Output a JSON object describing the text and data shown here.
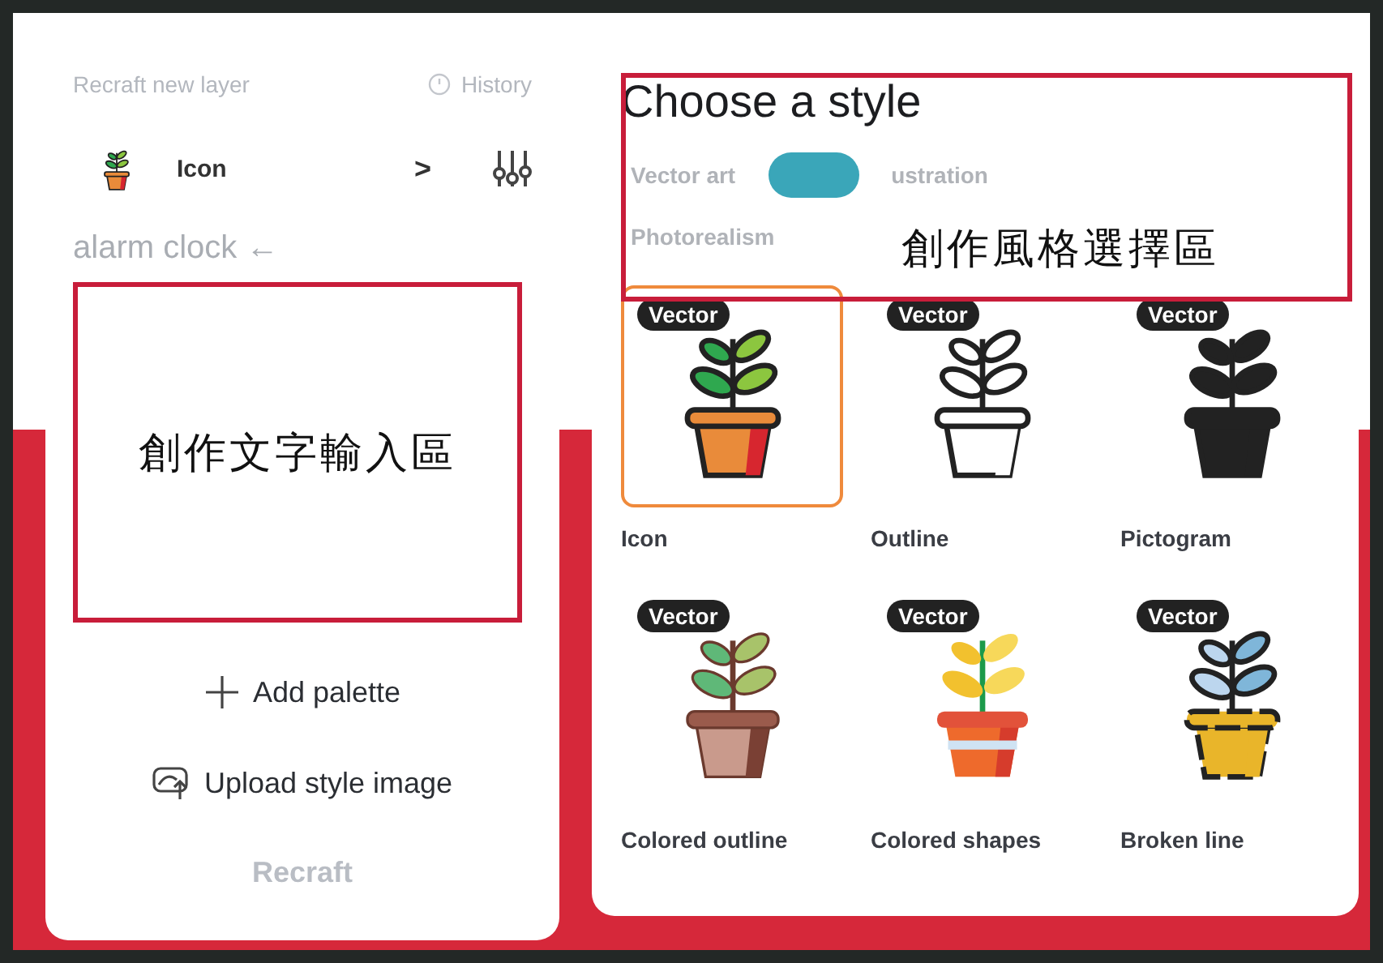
{
  "panel": {
    "title": "Recraft new layer",
    "history": "History",
    "model": {
      "label": "Icon",
      "chevron": ">"
    },
    "prompt": {
      "placeholder": "alarm clock ←"
    },
    "actions": [
      {
        "kind": "add",
        "label": "Add palette"
      },
      {
        "kind": "upload",
        "label": "Upload style image"
      }
    ],
    "submit": {
      "label": "Recraft",
      "disabled": true
    }
  },
  "styles": {
    "title": "Choose a style",
    "tabs": [
      {
        "label": "Vector art",
        "selected": false
      },
      {
        "selected": true
      },
      {
        "label": "ustration",
        "selected": false
      },
      {
        "label": "Photorealism",
        "selected": false
      }
    ],
    "items": [
      {
        "kind": "icon",
        "badge": "Vector",
        "label": "Icon",
        "selected": true
      },
      {
        "kind": "outline",
        "badge": "Vector",
        "label": "Outline",
        "selected": false
      },
      {
        "kind": "pictogram",
        "badge": "Vector",
        "label": "Pictogram",
        "selected": false
      },
      {
        "kind": "colored-outline",
        "badge": "Vector",
        "label": "Colored outline",
        "selected": false
      },
      {
        "kind": "colored-shapes",
        "badge": "Vector",
        "label": "Colored shapes",
        "selected": false
      },
      {
        "kind": "broken-line",
        "badge": "Vector",
        "label": "Broken line",
        "selected": false
      }
    ]
  },
  "annotations": [
    {
      "text": "創作文字輸入區"
    },
    {
      "text": "創作風格選擇區"
    }
  ]
}
